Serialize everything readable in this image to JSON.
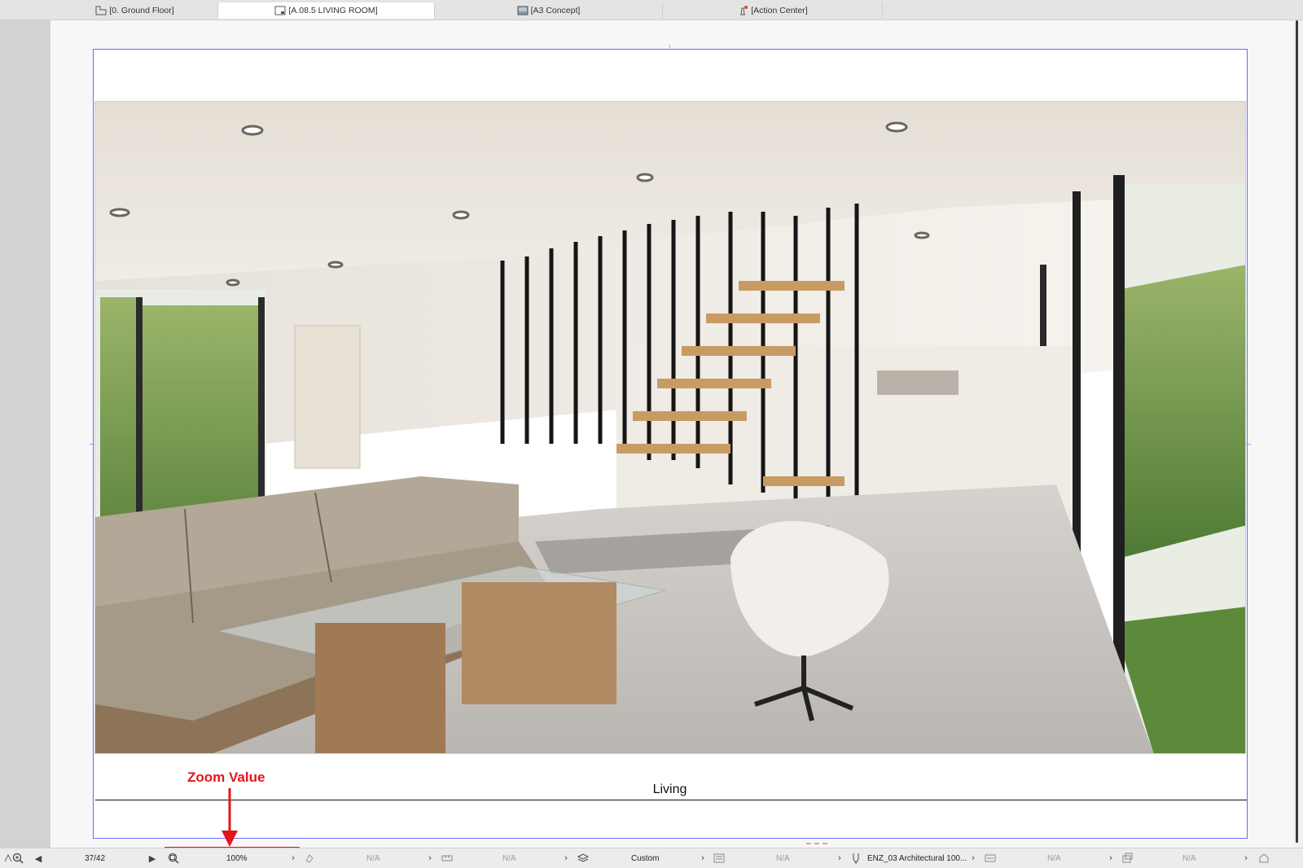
{
  "tabs": [
    {
      "label": "[0. Ground Floor]",
      "icon": "floor-plan-icon"
    },
    {
      "label": "[A.08.5 LIVING ROOM]",
      "icon": "layout-icon",
      "active": true
    },
    {
      "label": "[A3 Concept]",
      "icon": "image-icon"
    },
    {
      "label": "[Action Center]",
      "icon": "lighthouse-icon"
    }
  ],
  "drawing": {
    "caption": "Living",
    "image_subject": "rendered interior of a modern living room with sofa, glass coffee table, white chairs and a steel staircase"
  },
  "annotation": {
    "label": "Zoom Value",
    "color": "#e3151a"
  },
  "statusbar": {
    "page": "37/42",
    "zoom": "100%",
    "orientation": "N/A",
    "scale": "N/A",
    "layer_combination": "Custom",
    "pen_set": "N/A",
    "model_view": "ENZ_03 Architectural 100...",
    "dimension": "N/A",
    "renovation": "N/A"
  },
  "colors": {
    "sheet_border": "#6a6aff",
    "accent_red": "#e3151a"
  }
}
